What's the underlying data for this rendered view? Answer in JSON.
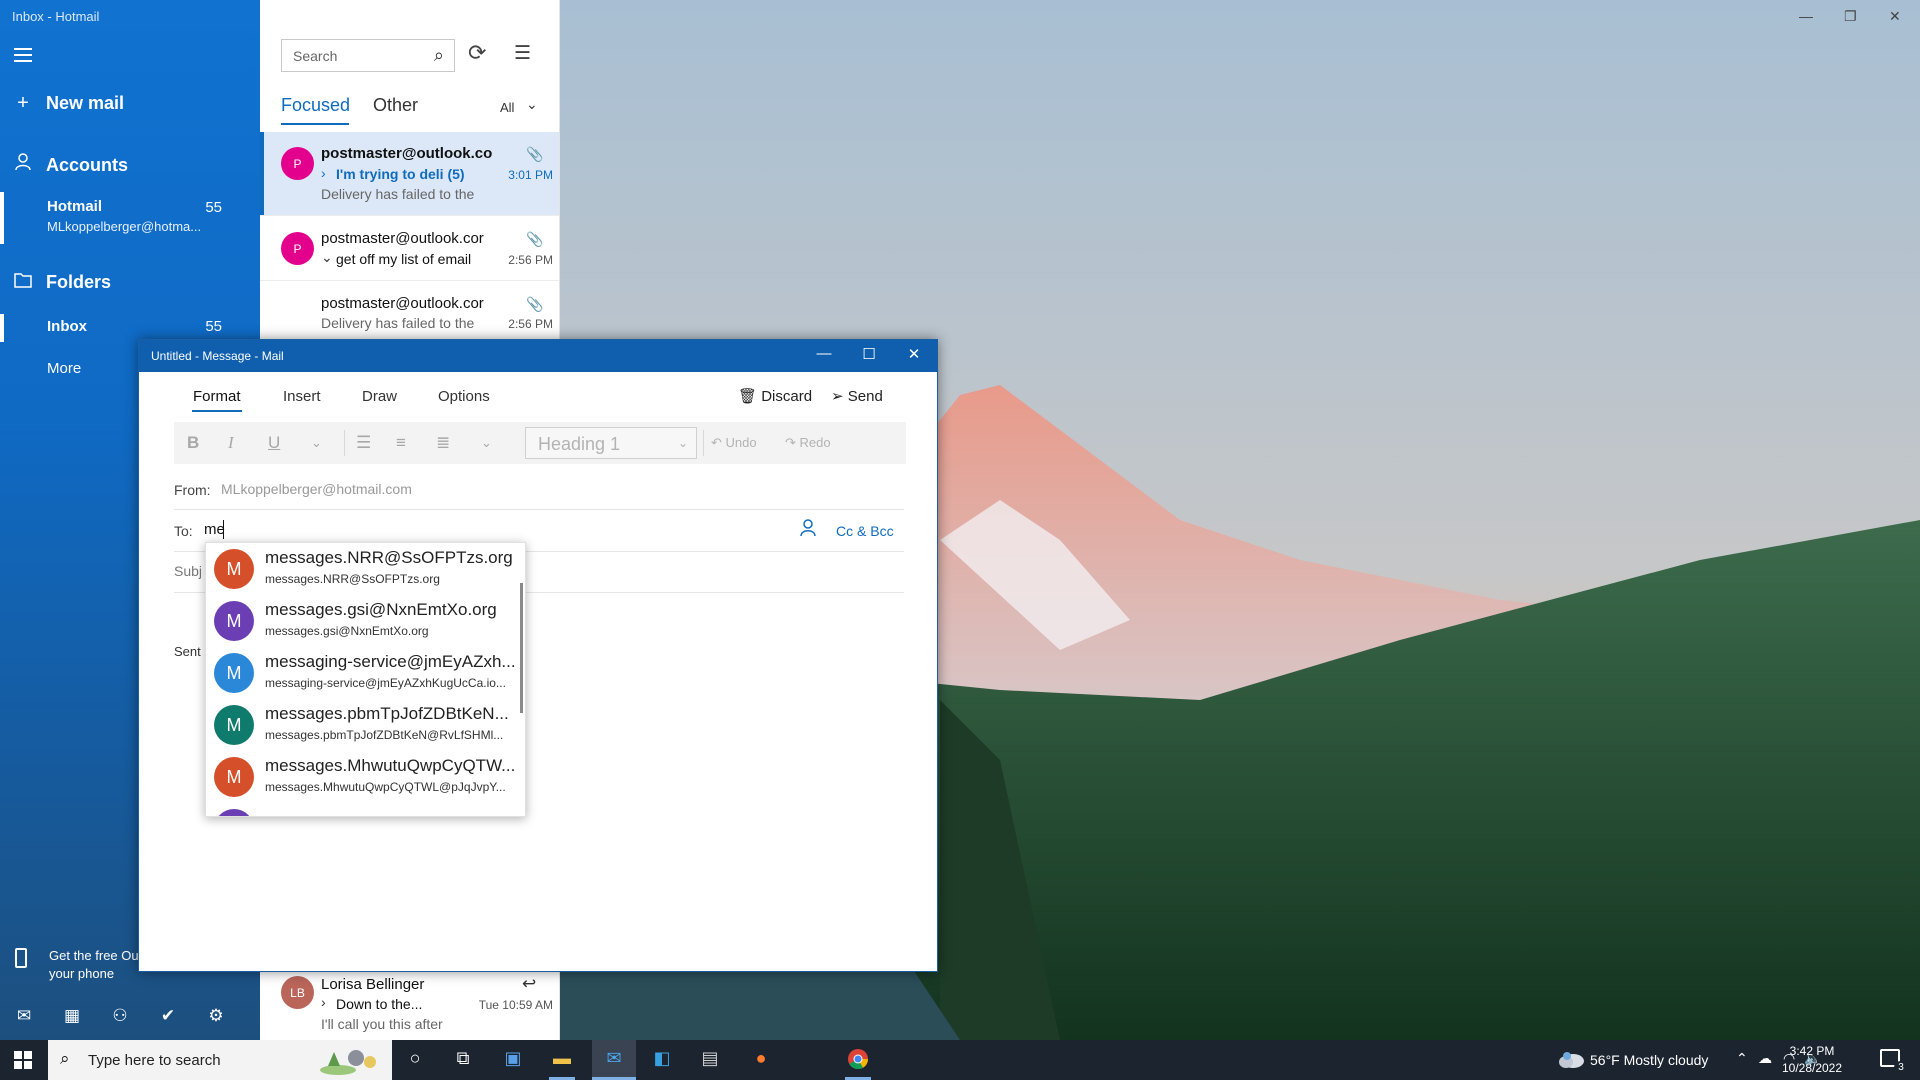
{
  "window": {
    "title": "Inbox - Hotmail"
  },
  "nav": {
    "new_mail": "New mail",
    "accounts": "Accounts",
    "account": {
      "name": "Hotmail",
      "count": "55",
      "email": "MLkoppelberger@hotma..."
    },
    "folders": "Folders",
    "inbox": {
      "name": "Inbox",
      "count": "55"
    },
    "more": "More",
    "promo_line1": "Get the free Ou",
    "promo_line2": "your phone"
  },
  "list": {
    "search_placeholder": "Search",
    "tab_focused": "Focused",
    "tab_other": "Other",
    "filter": "All",
    "messages": [
      {
        "avatar": "P",
        "avatar_color": "#e3008c",
        "sender": "postmaster@outlook.co",
        "subject": "I'm trying to deli  (5)",
        "time": "3:01 PM",
        "preview": "Delivery has failed to the"
      },
      {
        "avatar": "P",
        "avatar_color": "#e3008c",
        "sender": "postmaster@outlook.cor",
        "subject": "get off my list of email",
        "time": "2:56 PM",
        "preview": ""
      },
      {
        "avatar": "",
        "avatar_color": "",
        "sender": "postmaster@outlook.cor",
        "subject": "",
        "time": "2:56 PM",
        "preview": "Delivery has failed to the"
      },
      {
        "avatar": "LB",
        "avatar_color": "#b9655a",
        "sender": "Lorisa Bellinger",
        "subject": "Down to the...",
        "time": "Tue 10:59 AM",
        "preview": "I'll call you this after"
      }
    ]
  },
  "compose": {
    "title": "Untitled - Message - Mail",
    "tabs": [
      "Format",
      "Insert",
      "Draw",
      "Options"
    ],
    "discard": "Discard",
    "send": "Send",
    "toolbar": {
      "bold": "B",
      "italic": "I",
      "underline": "U",
      "heading": "Heading 1",
      "undo": "Undo",
      "redo": "Redo"
    },
    "from_label": "From:",
    "from_value": "MLkoppelberger@hotmail.com",
    "to_label": "To:",
    "to_value": "me",
    "cc_bcc": "Cc & Bcc",
    "subject_label": "Subj",
    "sent_label": "Sent"
  },
  "suggestions": [
    {
      "initial": "M",
      "color": "#d54f2a",
      "main": "messages.NRR@SsOFPTzs.org",
      "sub": "messages.NRR@SsOFPTzs.org"
    },
    {
      "initial": "M",
      "color": "#6b3fb3",
      "main": "messages.gsi@NxnEmtXo.org",
      "sub": "messages.gsi@NxnEmtXo.org"
    },
    {
      "initial": "M",
      "color": "#2b88d8",
      "main": "messaging-service@jmEyAZxh...",
      "sub": "messaging-service@jmEyAZxhKugUcCa.io..."
    },
    {
      "initial": "M",
      "color": "#0f7b6c",
      "main": "messages.pbmTpJofZDBtKeN...",
      "sub": "messages.pbmTpJofZDBtKeN@RvLfSHMl..."
    },
    {
      "initial": "M",
      "color": "#d54f2a",
      "main": "messages.MhwutuQwpCyQTW...",
      "sub": "messages.MhwutuQwpCyQTWL@pJqJvpY..."
    },
    {
      "initial": "M",
      "color": "#6b3fb3",
      "main": "",
      "sub": ""
    }
  ],
  "taskbar": {
    "search_placeholder": "Type here to search",
    "weather": "56°F  Mostly cloudy",
    "time": "3:42 PM",
    "date": "10/28/2022",
    "notifications": "3"
  }
}
